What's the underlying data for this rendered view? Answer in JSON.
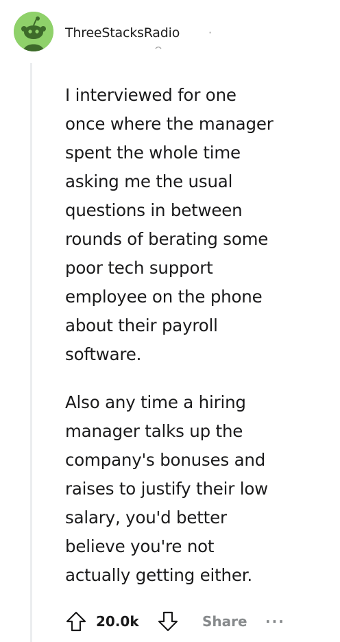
{
  "comment": {
    "author": "ThreeStacksRadio",
    "separator": "·",
    "avatar_icon": "reddit-snoo-avatar-icon",
    "paragraphs": [
      {
        "lines": [
          "I interviewed for one",
          "once where the manager",
          "spent the whole time",
          "asking me the usual",
          "questions in between",
          "rounds of berating some",
          "poor tech support",
          "employee on the phone",
          "about their payroll",
          "software."
        ]
      },
      {
        "lines": [
          "Also any time a hiring",
          "manager talks up the",
          "company's bonuses and",
          "raises to justify their low",
          "salary, you'd better",
          "believe you're not",
          "actually getting either."
        ]
      }
    ],
    "actions": {
      "upvote_icon": "upvote-arrow-icon",
      "score": "20.0k",
      "downvote_icon": "downvote-arrow-icon",
      "share_label": "Share",
      "more_label": "···"
    }
  },
  "colors": {
    "avatar_bg": "#8fd16a",
    "thread_line": "#ebedef",
    "text": "#1a1a1b",
    "muted": "#878a8c"
  }
}
